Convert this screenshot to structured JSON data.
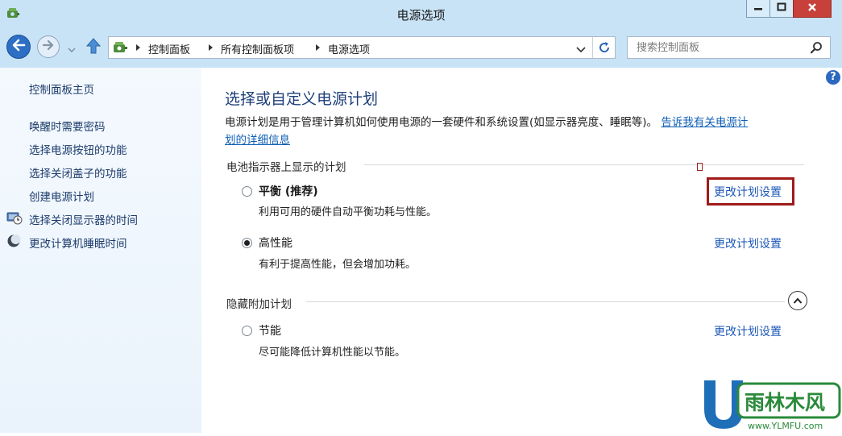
{
  "window": {
    "title": "电源选项"
  },
  "navigation": {
    "breadcrumbs": [
      "控制面板",
      "所有控制面板项",
      "电源选项"
    ]
  },
  "search": {
    "placeholder": "搜索控制面板"
  },
  "sidebar": {
    "home": "控制面板主页",
    "items": [
      {
        "label": "唤醒时需要密码",
        "icon": null
      },
      {
        "label": "选择电源按钮的功能",
        "icon": null
      },
      {
        "label": "选择关闭盖子的功能",
        "icon": null
      },
      {
        "label": "创建电源计划",
        "icon": null
      },
      {
        "label": "选择关闭显示器的时间",
        "icon": "display-schedule-icon"
      },
      {
        "label": "更改计算机睡眠时间",
        "icon": "sleep-moon-icon"
      }
    ]
  },
  "main": {
    "title": "选择或自定义电源计划",
    "description": "电源计划是用于管理计算机如何使用电源的一套硬件和系统设置(如显示器亮度、睡眠等)。",
    "description_link_line1": "告诉我有关电源计",
    "description_link_line2": "划的详细信息",
    "battery_group_label": "电池指示器上显示的计划",
    "hidden_group_label": "隐藏附加计划",
    "change_plan_label": "更改计划设置",
    "plans": [
      {
        "name": "平衡 (推荐)",
        "description": "利用可用的硬件自动平衡功耗与性能。",
        "selected": false,
        "bold": true
      },
      {
        "name": "高性能",
        "description": "有利于提高性能，但会增加功耗。",
        "selected": true,
        "bold": false
      },
      {
        "name": "节能",
        "description": "尽可能降低计算机性能以节能。",
        "selected": false,
        "bold": false
      }
    ]
  },
  "watermark": {
    "brand": "雨林木风",
    "url": "www.YLMFU.com"
  },
  "colors": {
    "title_bar": "#c9e3f6",
    "link": "#1d58b6",
    "highlight": "#a01a1a",
    "close_button": "#c7403a"
  }
}
